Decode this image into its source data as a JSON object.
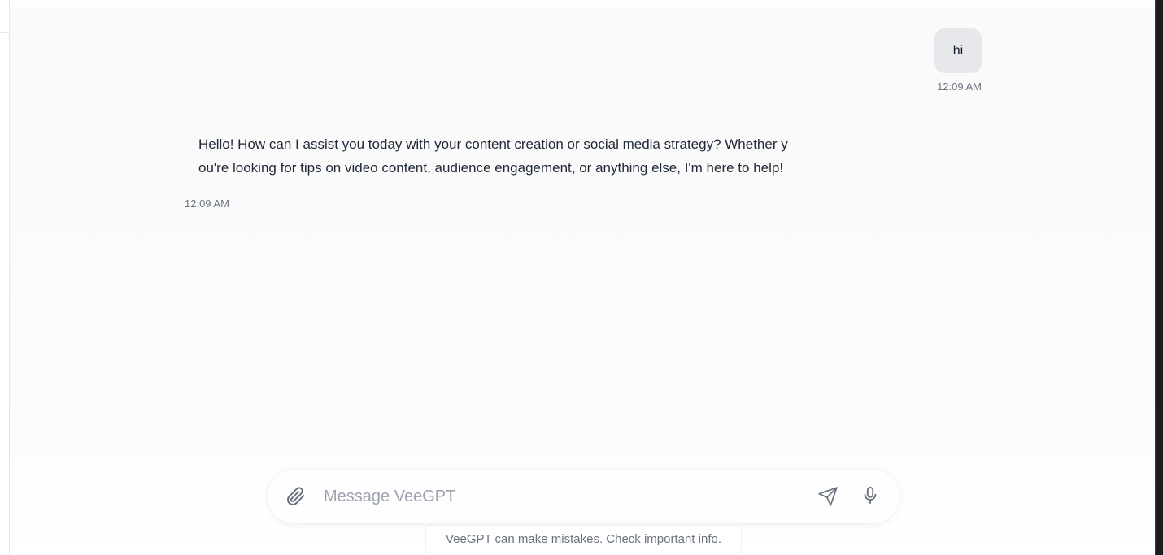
{
  "conversation": {
    "user_message": {
      "text": "hi",
      "time": "12:09 AM"
    },
    "assistant_message": {
      "lines": [
        "Hello! How can I assist you today with your content creation or social media strategy? Whether y",
        "ou're looking for tips on video content, audience engagement, or anything else, I'm here to help!"
      ],
      "time": "12:09 AM"
    }
  },
  "composer": {
    "placeholder": "Message VeeGPT",
    "value": "",
    "attach_icon": "paperclip-icon",
    "send_icon": "send-icon",
    "mic_icon": "microphone-icon"
  },
  "footer": {
    "disclaimer": "VeeGPT can make mistakes. Check important info."
  },
  "colors": {
    "user_bubble": "#e7e8ec",
    "text": "#1f2937",
    "muted": "#6b7280",
    "icon": "#6b7280"
  }
}
